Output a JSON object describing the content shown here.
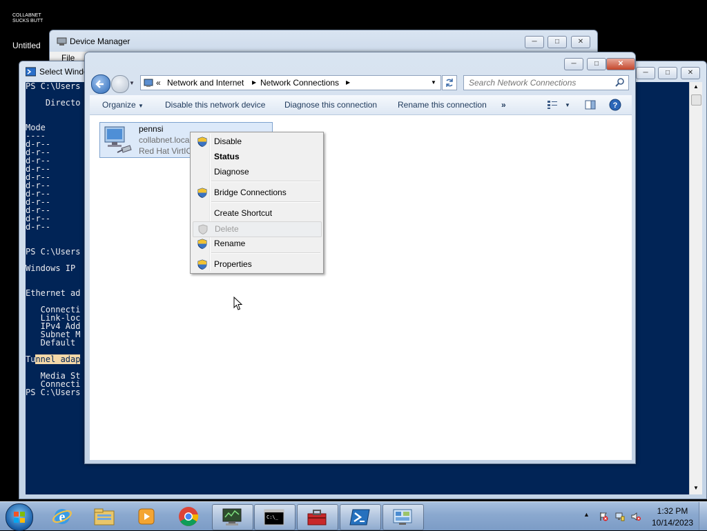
{
  "desktop": {
    "icon_label": "COLLABNET\nSUCKS BUTT",
    "untitled_label": "Untitled"
  },
  "device_manager": {
    "title": "Device Manager",
    "menu_file": "File"
  },
  "powershell": {
    "title": "Select Windo",
    "lines": [
      "PS C:\\Users",
      "",
      "    Directo",
      "",
      "",
      "Mode",
      "----",
      "d-r--",
      "d-r--",
      "d-r--",
      "d-r--",
      "d-r--",
      "d-r--",
      "d-r--",
      "d-r--",
      "d-r--",
      "d-r--",
      "d-r--",
      "",
      "",
      "PS C:\\Users",
      "",
      "Windows IP",
      "",
      "",
      "Ethernet ad",
      "",
      "   Connecti",
      "   Link-loc",
      "   IPv4 Add",
      "   Subnet M",
      "   Default",
      "",
      "Tunnel adap",
      "",
      "   Media St",
      "   Connecti",
      "PS C:\\Users"
    ]
  },
  "explorer": {
    "breadcrumb": [
      "Network and Internet",
      "Network Connections"
    ],
    "breadcrumb_prefix": "«",
    "search_placeholder": "Search Network Connections",
    "commands": [
      "Organize",
      "Disable this network device",
      "Diagnose this connection",
      "Rename this connection"
    ],
    "more": "»",
    "connection": {
      "name": "pennsi",
      "network": "collabnet.loca",
      "device": "Red Hat VirtIO"
    }
  },
  "context_menu": {
    "items": [
      {
        "label": "Disable",
        "shield": true
      },
      {
        "label": "Status",
        "bold": true
      },
      {
        "label": "Diagnose"
      },
      {
        "label": "Bridge Connections",
        "shield": true
      },
      {
        "label": "Create Shortcut"
      },
      {
        "label": "Delete",
        "disabled": true
      },
      {
        "label": "Rename",
        "shield": true
      },
      {
        "label": "Properties",
        "shield": true
      }
    ]
  },
  "taskbar": {
    "pinned": [
      "start-orb",
      "internet-explorer-icon",
      "windows-explorer-icon",
      "media-player-icon",
      "chrome-icon",
      "network-monitor-icon",
      "command-prompt-icon",
      "toolbox-icon",
      "powershell-icon",
      "control-panel-icon"
    ],
    "time": "1:32 PM",
    "date": "10/14/2023"
  },
  "colors": {
    "powershell_bg": "#012456",
    "explorer_frame": "#c3d3e6",
    "taskbar": "#8aa8cf",
    "close_button": "#c3462a"
  }
}
